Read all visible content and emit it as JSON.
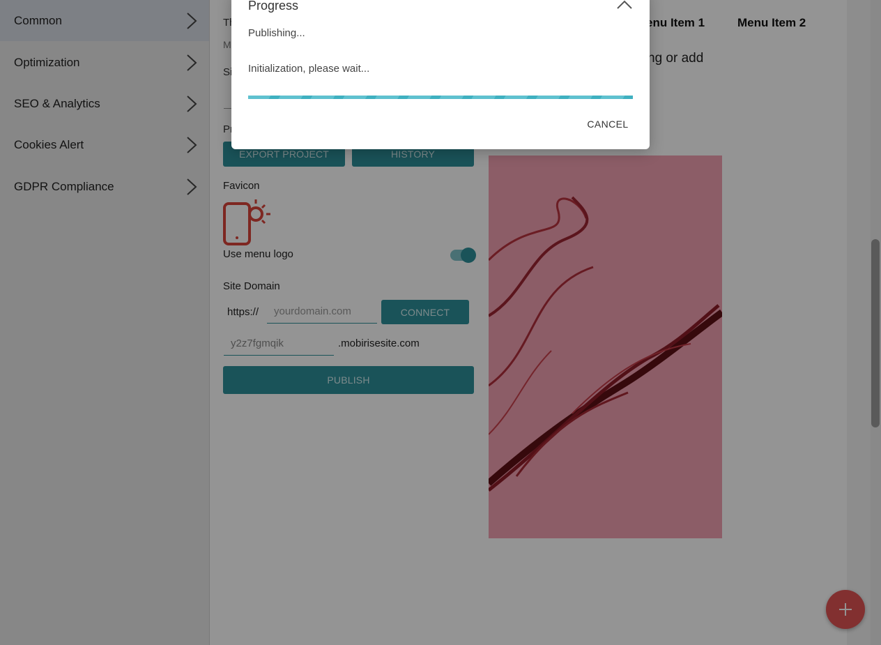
{
  "sidebar": {
    "items": [
      {
        "label": "Common",
        "active": true
      },
      {
        "label": "Optimization"
      },
      {
        "label": "SEO & Analytics"
      },
      {
        "label": "Cookies Alert"
      },
      {
        "label": "GDPR Compliance"
      }
    ]
  },
  "panel": {
    "peek_th": "Th",
    "peek_m": "M",
    "peek_si": "Si",
    "peek_pr": "Pr",
    "export_button": "EXPORT PROJECT",
    "history_button": "HISTORY",
    "favicon_label": "Favicon",
    "use_menu_logo_label": "Use menu logo",
    "use_menu_logo_on": true,
    "site_domain_label": "Site Domain",
    "protocol_prefix": "https://",
    "domain_placeholder": "yourdomain.com",
    "connect_button": "CONNECT",
    "subdomain_value": "y2z7fgmqik",
    "subdomain_suffix": ".mobirisesite.com",
    "publish_button": "PUBLISH"
  },
  "preview": {
    "menu_item_1": "enu Item 1",
    "menu_item_2": "Menu Item 2",
    "hero_text_fragment": "ng or add"
  },
  "dialog": {
    "title": "Progress",
    "status": "Publishing...",
    "message": "Initialization, please wait...",
    "progress_fraction": 1.0,
    "cancel_button": "CANCEL"
  },
  "colors": {
    "accent": "#2d8f9a",
    "favicon": "#d9443a",
    "fab": "#e05353",
    "progress": "#5fc1cf"
  }
}
